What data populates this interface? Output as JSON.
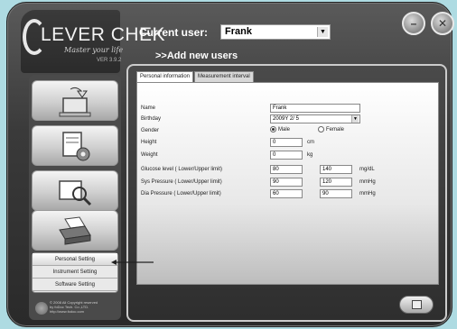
{
  "app": {
    "logo_text": "LEVER CHEK",
    "logo_tagline": "Master your life",
    "version": "VER 3.9.2"
  },
  "header": {
    "current_user_label": "Current user:",
    "current_user_value": "Frank",
    "add_users_label": ">>Add new users"
  },
  "window_buttons": {
    "minimize_icon": "minimize-icon",
    "close_icon": "close-icon"
  },
  "sidebar": {
    "items": [
      {
        "icon": "computer-transfer-icon"
      },
      {
        "icon": "document-settings-icon"
      },
      {
        "icon": "magnifier-document-icon"
      },
      {
        "icon": "printer-icon"
      }
    ],
    "submenu": [
      {
        "label": "Personal Setting",
        "active": true
      },
      {
        "label": "Instrument Setting",
        "active": false
      },
      {
        "label": "Software Setting",
        "active": false
      }
    ],
    "copyright_lines": [
      "© 2008 All Copyright reserved",
      "by foDoc Tech. Co.,LTD.",
      "http://www.fodoc.com"
    ]
  },
  "tabs": [
    {
      "label": "Personal information",
      "active": true
    },
    {
      "label": "Measurement interval",
      "active": false
    }
  ],
  "form": {
    "name_label": "Name",
    "name_value": "Frank",
    "birthday_label": "Birthday",
    "birthday_value": "2009Y 2/ 5",
    "gender_label": "Gender",
    "gender_male": "Male",
    "gender_female": "Female",
    "gender_selected": "Male",
    "height_label": "Height",
    "height_value": "0",
    "height_unit": "cm",
    "weight_label": "Weight",
    "weight_value": "0",
    "weight_unit": "kg",
    "glucose_label": "Glucose level ( Lower/Upper limit)",
    "glucose_lower": "80",
    "glucose_upper": "140",
    "glucose_unit": "mg/dL",
    "sys_label": "Sys Pressure ( Lower/Upper limit)",
    "sys_lower": "90",
    "sys_upper": "120",
    "sys_unit": "mmHg",
    "dia_label": "Dia Pressure ( Lower/Upper limit)",
    "dia_lower": "60",
    "dia_upper": "90",
    "dia_unit": "mmHg"
  },
  "colors": {
    "background": "#aedbe2",
    "frame": "#3a3a3a",
    "panel_border": "#cccccc"
  }
}
